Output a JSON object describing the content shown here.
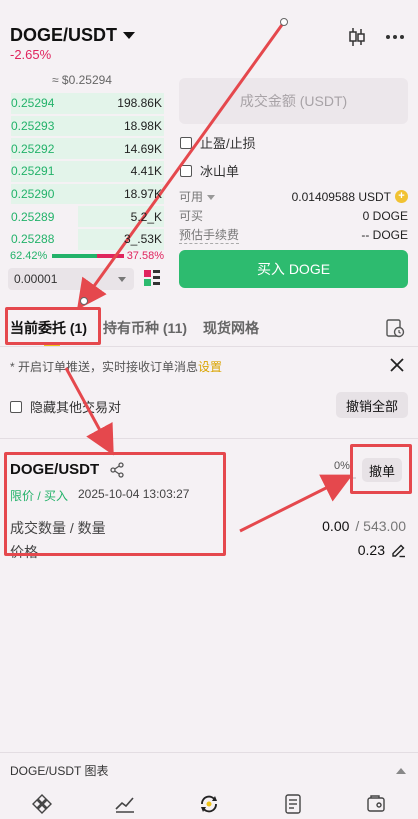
{
  "header": {
    "pair": "DOGE/USDT",
    "change": "-2.65%",
    "icons": [
      "candlestick-icon",
      "more-icon"
    ]
  },
  "orderbook": {
    "ref_price": "≈ $0.25294",
    "rows": [
      {
        "price": "0.25294",
        "qty": "198.86K",
        "depth": 0.98
      },
      {
        "price": "0.25293",
        "qty": "18.98K",
        "depth": 0.98
      },
      {
        "price": "0.25292",
        "qty": "14.69K",
        "depth": 0.98
      },
      {
        "price": "0.25291",
        "qty": "4.41K",
        "depth": 0.98
      },
      {
        "price": "0.25290",
        "qty": "18.97K",
        "depth": 0.98
      },
      {
        "price": "0.25289",
        "qty": "5.2_K",
        "depth": 0.55
      },
      {
        "price": "0.25288",
        "qty": "3_.53K",
        "depth": 0.55
      }
    ],
    "buy_ratio": "62.42%",
    "sell_ratio": "37.58%",
    "precision": "0.00001"
  },
  "form": {
    "amount_placeholder": "成交金额 (USDT)",
    "tp_sl": "止盈/止损",
    "iceberg": "冰山单",
    "available_label": "可用",
    "available_value": "0.01409588 USDT",
    "can_buy_label": "可买",
    "can_buy_value": "0 DOGE",
    "fee_label": "预估手续费",
    "fee_value": "-- DOGE",
    "buy_button": "买入 DOGE"
  },
  "tabs": [
    {
      "label": "当前委托 (1)",
      "active": true
    },
    {
      "label": "持有币种 (11)",
      "active": false
    },
    {
      "label": "现货网格",
      "active": false
    }
  ],
  "notice": {
    "text": "* 开启订单推送，实时接收订单消息",
    "link": "设置"
  },
  "filters": {
    "hide_other": "隐藏其他交易对",
    "cancel_all": "撤销全部"
  },
  "order": {
    "pair": "DOGE/USDT",
    "type": "限价 / 买入",
    "time": "2025-10-04 13:03:27",
    "progress": "0%",
    "cancel": "撤单",
    "filled_label": "成交数量 / 数量",
    "filled": "0.00",
    "amount": "/ 543.00",
    "price_label": "价格",
    "price": "0.23"
  },
  "bottom": {
    "chart_label": "DOGE/USDT 图表"
  },
  "nav_icons": [
    "home-icon",
    "markets-icon",
    "trade-icon",
    "futures-icon",
    "assets-icon"
  ],
  "colors": {
    "green": "#2dbb6f",
    "red": "#e0245e",
    "highlight": "#e5484d",
    "accent_yellow": "#f0c419"
  }
}
